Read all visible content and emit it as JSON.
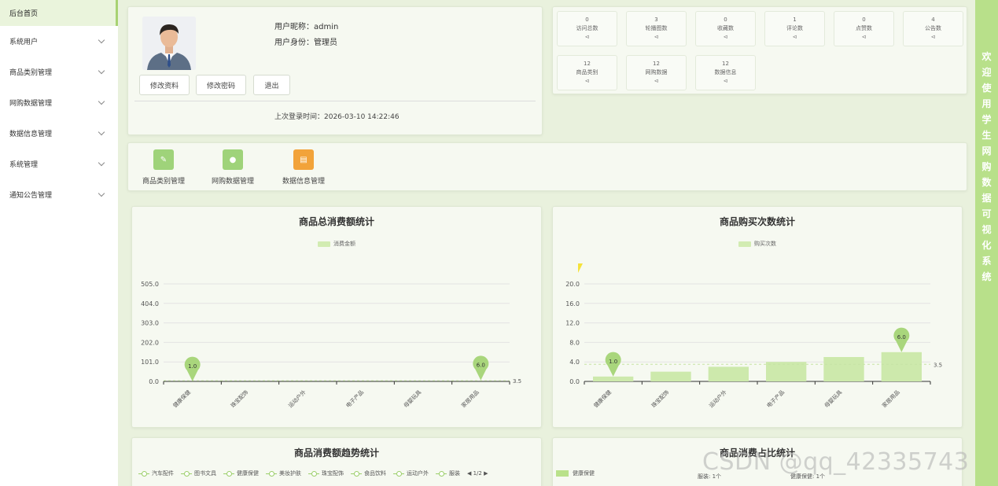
{
  "sidebar": {
    "home": "后台首页",
    "items": [
      {
        "label": "系统用户"
      },
      {
        "label": "商品类别管理"
      },
      {
        "label": "网购数据管理"
      },
      {
        "label": "数据信息管理"
      },
      {
        "label": "系统管理"
      },
      {
        "label": "通知公告管理"
      }
    ]
  },
  "welcome_strip": {
    "text": "欢迎使用学生网购数据可视化系统"
  },
  "profile": {
    "nickname": "用户昵称：admin",
    "role": "用户身份：管理员",
    "buttons": [
      "修改资料",
      "修改密码",
      "退出"
    ],
    "last_login": "上次登录时间：2026-03-10 14:22:46"
  },
  "stats": [
    {
      "value": "0",
      "label": "访问总数",
      "arrow": "⊲"
    },
    {
      "value": "3",
      "label": "轮播图数",
      "arrow": "⊲"
    },
    {
      "value": "0",
      "label": "收藏数",
      "arrow": "⊲"
    },
    {
      "value": "1",
      "label": "评论数",
      "arrow": "⊲"
    },
    {
      "value": "0",
      "label": "点赞数",
      "arrow": "⊲"
    },
    {
      "value": "4",
      "label": "公告数",
      "arrow": "⊲"
    },
    {
      "value": "12",
      "label": "商品类别",
      "arrow": "⊲"
    },
    {
      "value": "12",
      "label": "网购数据",
      "arrow": "⊲"
    },
    {
      "value": "12",
      "label": "数据信息",
      "arrow": "⊲"
    }
  ],
  "quick_links": [
    {
      "label": "商品类别管理",
      "icon": "pencil-icon",
      "color": "#9fd37a"
    },
    {
      "label": "网购数据管理",
      "icon": "location-icon",
      "color": "#9fd37a"
    },
    {
      "label": "数据信息管理",
      "icon": "document-icon",
      "color": "#f2a33a"
    }
  ],
  "chart_data": [
    {
      "type": "line",
      "title": "商品总消费额统计",
      "categories": [
        "健康保健",
        "珠宝配饰",
        "运动户外",
        "电子产品",
        "母婴玩具",
        "家居用品"
      ],
      "series": [
        {
          "name": "消费金额",
          "values": [
            1.0,
            2.0,
            2.6,
            4.0,
            5.2,
            6.0
          ]
        }
      ],
      "yticks": [
        "0.0",
        "101.0",
        "202.0",
        "303.0",
        "404.0",
        "505.0"
      ],
      "ylim": [
        0,
        505
      ],
      "markpoints": [
        {
          "label": "1.0",
          "category": "健康保健",
          "value": 1.0
        },
        {
          "label": "6.0",
          "category": "家居用品",
          "value": 6.0
        }
      ],
      "average": {
        "label": "3.5",
        "value": 3.5
      },
      "legend": "top-center",
      "grid": true
    },
    {
      "type": "bar",
      "title": "商品购买次数统计",
      "categories": [
        "健康保健",
        "珠宝配饰",
        "运动户外",
        "电子产品",
        "母婴玩具",
        "家居用品"
      ],
      "series": [
        {
          "name": "购买次数",
          "values": [
            1.0,
            2.0,
            3.0,
            4.0,
            5.0,
            6.0
          ]
        }
      ],
      "yticks": [
        "0.0",
        "4.0",
        "8.0",
        "12.0",
        "16.0",
        "20.0"
      ],
      "ylim": [
        0,
        20
      ],
      "markpoints": [
        {
          "label": "1.0",
          "category": "健康保健",
          "value": 1.0
        },
        {
          "label": "6.0",
          "category": "家居用品",
          "value": 6.0
        }
      ],
      "average": {
        "label": "3.5",
        "value": 3.5
      },
      "legend": "top-center",
      "grid": true
    }
  ],
  "trend_chart": {
    "title": "商品消费额趋势统计",
    "legend": [
      "汽车配件",
      "图书文具",
      "健康保健",
      "美妆护肤",
      "珠宝配饰",
      "食品饮料",
      "运动户外",
      "服装"
    ],
    "pager": "1/2"
  },
  "share_chart": {
    "title": "商品消费占比统计",
    "legend": [
      "健康保健"
    ],
    "labels": [
      "服装: 1个",
      "健康保健: 1个"
    ]
  },
  "watermark": "CSDN @qq_42335743"
}
